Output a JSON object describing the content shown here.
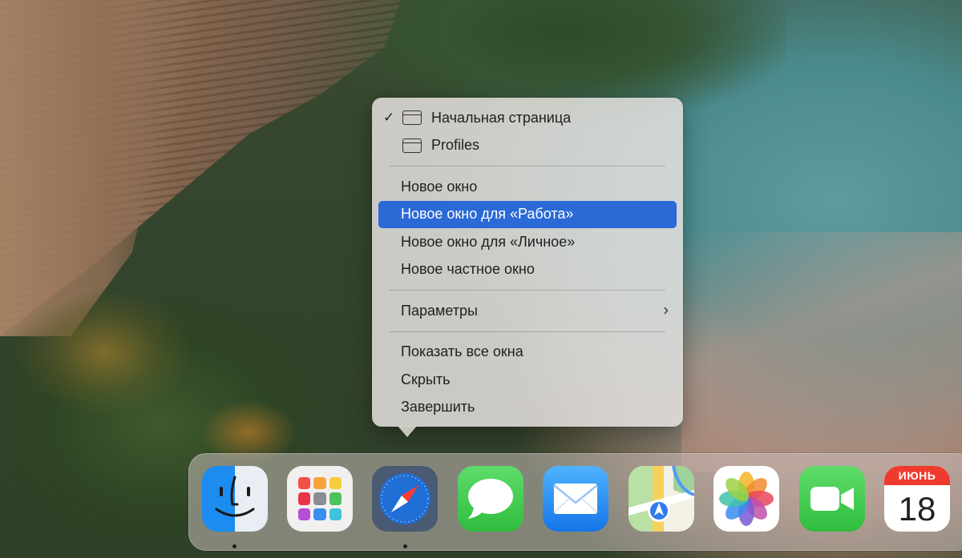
{
  "menu": {
    "window_items": [
      {
        "label": "Начальная страница",
        "checked": true,
        "icon": "window-icon"
      },
      {
        "label": "Profiles",
        "checked": false,
        "icon": "window-icon"
      }
    ],
    "new_window": "Новое окно",
    "new_window_work": "Новое окно для «Работа»",
    "new_window_personal": "Новое окно для «Личное»",
    "new_private_window": "Новое частное окно",
    "options": "Параметры",
    "show_all_windows": "Показать все окна",
    "hide": "Скрыть",
    "quit": "Завершить",
    "highlighted_item": "Новое окно для «Работа»",
    "highlight_color": "#2a69d6"
  },
  "dock": {
    "apps": [
      {
        "name": "Finder",
        "icon": "finder-icon",
        "running": true
      },
      {
        "name": "Launchpad",
        "icon": "launchpad-icon",
        "running": false
      },
      {
        "name": "Safari",
        "icon": "safari-icon",
        "running": true
      },
      {
        "name": "Messages",
        "icon": "messages-icon",
        "running": false
      },
      {
        "name": "Mail",
        "icon": "mail-icon",
        "running": false
      },
      {
        "name": "Maps",
        "icon": "maps-icon",
        "running": false
      },
      {
        "name": "Photos",
        "icon": "photos-icon",
        "running": false
      },
      {
        "name": "FaceTime",
        "icon": "facetime-icon",
        "running": false
      },
      {
        "name": "Calendar",
        "icon": "calendar-icon",
        "running": false
      }
    ],
    "calendar": {
      "month": "ИЮНЬ",
      "day": "18"
    }
  }
}
